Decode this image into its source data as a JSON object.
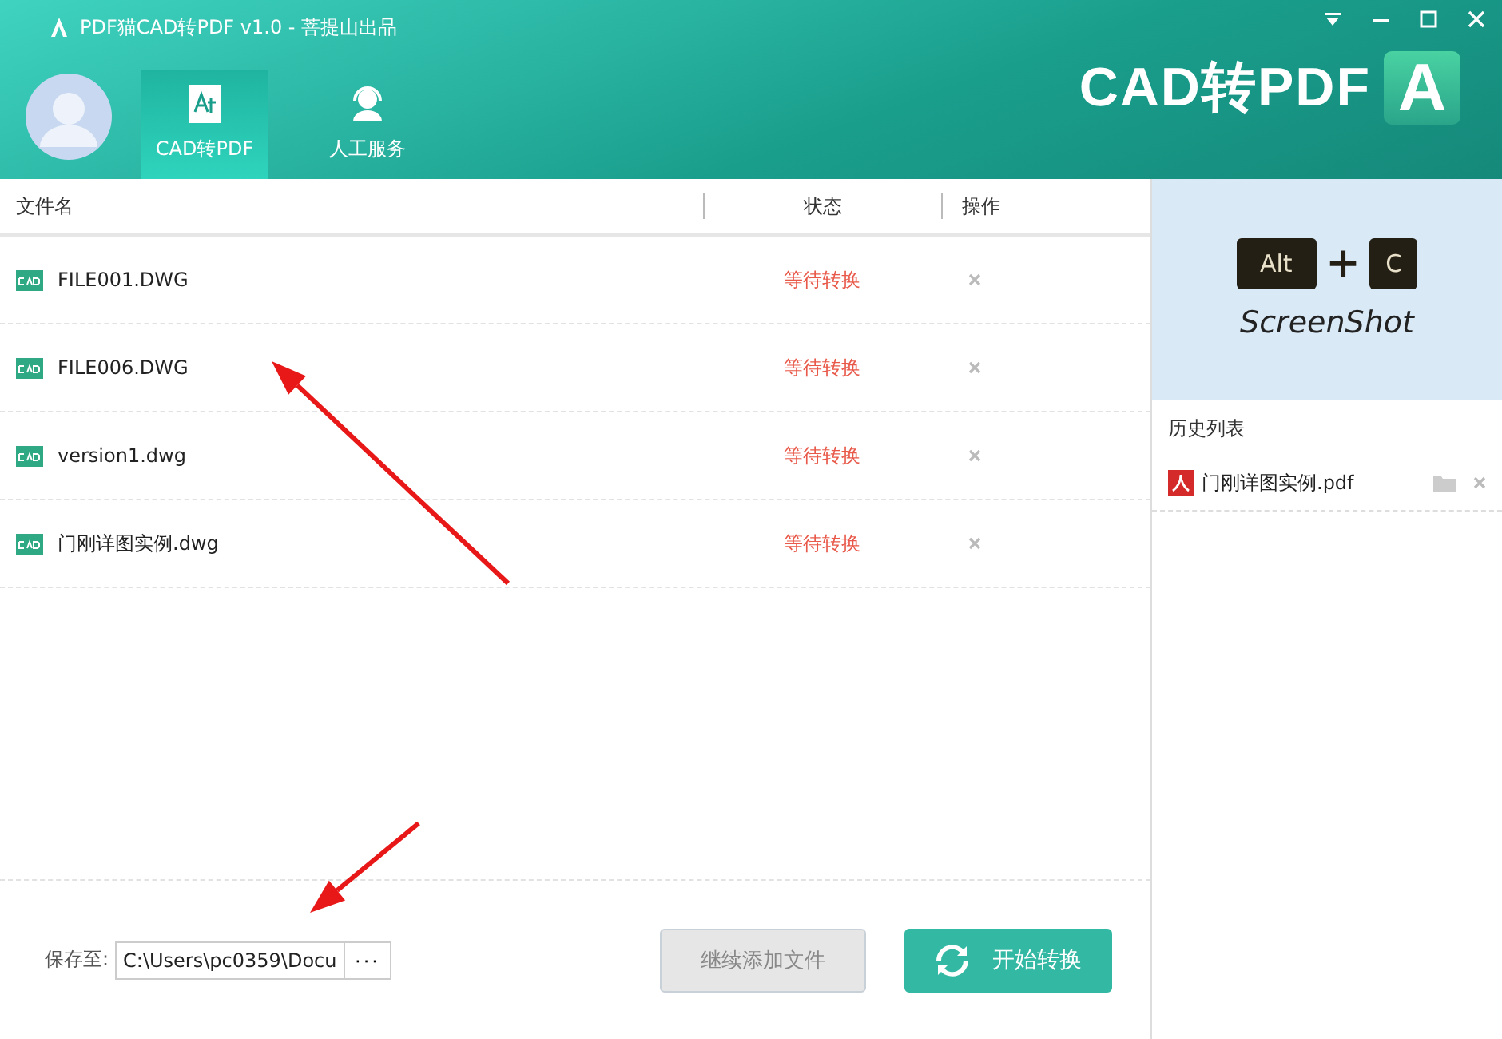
{
  "window": {
    "title": "PDF猫CAD转PDF v1.0 - 菩提山出品"
  },
  "nav_tabs": [
    {
      "label": "CAD转PDF",
      "selected": true
    },
    {
      "label": "人工服务",
      "selected": false
    }
  ],
  "logo": {
    "text": "CAD转PDF",
    "badge": "A"
  },
  "table": {
    "columns": [
      "文件名",
      "状态",
      "操作"
    ],
    "rows": [
      {
        "name": "FILE001.DWG",
        "status": "等待转换"
      },
      {
        "name": "FILE006.DWG",
        "status": "等待转换"
      },
      {
        "name": "version1.dwg",
        "status": "等待转换"
      },
      {
        "name": "门刚详图实例.dwg",
        "status": "等待转换"
      }
    ]
  },
  "save_to": {
    "label": "保存至:",
    "value": "C:\\Users\\pc0359\\Docu",
    "browse": "···"
  },
  "buttons": [
    {
      "label": "继续添加文件",
      "disabled": true,
      "kind": "plain"
    },
    {
      "label": "开始转换",
      "disabled": false,
      "kind": "primary"
    }
  ],
  "banner": {
    "key1": "Alt",
    "plus": "+",
    "key2": "C",
    "caption": "ScreenShot"
  },
  "history": {
    "title": "历史列表",
    "items": [
      {
        "name": "门刚详图实例.pdf"
      }
    ]
  },
  "annotations": [
    {
      "kind": "arrow"
    },
    {
      "kind": "arrow"
    }
  ]
}
